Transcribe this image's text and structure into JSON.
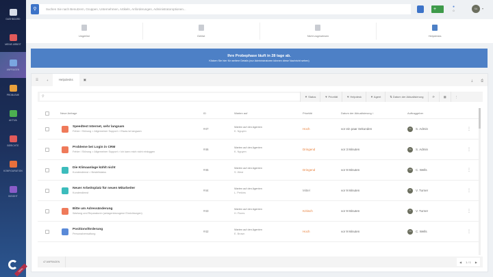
{
  "sidebar": {
    "items": [
      {
        "label": "DASHBOARD",
        "color": "#d8dde8"
      },
      {
        "label": "MEINE ARBEIT",
        "color": "#e05a5a"
      },
      {
        "label": "ANFRAGEN",
        "color": "#7aa6e0"
      },
      {
        "label": "PROBLEME",
        "color": "#e8a03c"
      },
      {
        "label": "AKTIVA",
        "color": "#4caf50"
      },
      {
        "label": "BERICHTE",
        "color": "#e05a5a"
      },
      {
        "label": "KONFIGURATION",
        "color": "#e8703c"
      },
      {
        "label": "INSIGHT",
        "color": "#8a5cc8"
      }
    ],
    "trial": "TRIAL"
  },
  "search": {
    "placeholder": "Suchen Sie nach Benutzern, Gruppen, Unternehmen, Artikeln, Anforderungen, Administratoroptionen..."
  },
  "header": {
    "notifications": "0",
    "avatar": "SA"
  },
  "nav": [
    {
      "label": "Ungelöst"
    },
    {
      "label": "Gelöst"
    },
    {
      "label": "Nicht zugewiesen"
    },
    {
      "label": "Helpdesks"
    }
  ],
  "banner": {
    "title": "Ihre Probephase läuft in 28 tage ab.",
    "subtitle": "Klicken Sie hier für weitere Details (nur Administratoren können diese Nachricht sehen)"
  },
  "tabs": {
    "active": "Helpdesks"
  },
  "filters": [
    "Status",
    "Priorität",
    "Helpdesk",
    "Agent",
    "Datum der Aktualisierung"
  ],
  "columns": [
    "Neue Anfrage",
    "ID",
    "Warten auf",
    "Priorität",
    "Datum der Aktualisierung ↕",
    "Auftraggeber"
  ],
  "rows": [
    {
      "title": "Speedtest Internet, sehr langsam",
      "path": "Fehler / Störung  >  Allgemeiner Support  >  Etwas ist langsam",
      "id": "#47",
      "wait": "Warten auf den Agenten",
      "agent": "K. Nguyen",
      "priority": "Hoch",
      "pcolor": "#e8803c",
      "date": "vor ein paar Sekunden",
      "initials": "SA",
      "requester": "S. Admin",
      "icolor": "#ef7a5a"
    },
    {
      "title": "Probleme bei Login in CRM",
      "path": "Fehler / Störung  >  Allgemeiner Support  >  Ich kann mich nicht einloggen",
      "id": "#46",
      "wait": "Warten auf den Agenten",
      "agent": "K. Nguyen",
      "priority": "Dringend",
      "pcolor": "#e8803c",
      "date": "vor 3 Minuten",
      "initials": "SA",
      "requester": "S. Admin",
      "icolor": "#ef7a5a"
    },
    {
      "title": "Die Klimaanlage kühlt nicht",
      "path": "Kundendienst  >  Bestellstatus",
      "id": "#45",
      "wait": "Warten auf den Agenten",
      "agent": "S. West",
      "priority": "Dringend",
      "pcolor": "#e8803c",
      "date": "vor 9 Minuten",
      "initials": "CW",
      "requester": "C. Wells",
      "icolor": "#3cbcbc"
    },
    {
      "title": "Neuer Arbeitsplatz für neuen Mitarbeiter",
      "path": "Kundendienst",
      "id": "#44",
      "wait": "Warten auf den Agenten",
      "agent": "L. Perkins",
      "priority": "Mittel",
      "pcolor": "#888888",
      "date": "vor 9 Minuten",
      "initials": "VT",
      "requester": "V. Turner",
      "icolor": "#3cbcbc"
    },
    {
      "title": "Bitte um Adressänderung",
      "path": "Wartung und Reparaturen (anlagenbezogene Einrichtungen)",
      "id": "#43",
      "wait": "Warten auf den Agenten",
      "agent": "H. Flores",
      "priority": "Kritisch",
      "pcolor": "#e8803c",
      "date": "vor 9 Minuten",
      "initials": "VT",
      "requester": "V. Turner",
      "icolor": "#ef7a5a"
    },
    {
      "title": "Positionsförderung",
      "path": "Personalverwaltung",
      "id": "#42",
      "wait": "Warten auf den Agenten",
      "agent": "E. Brown",
      "priority": "Hoch",
      "pcolor": "#e8803c",
      "date": "vor 9 Minuten",
      "initials": "CW",
      "requester": "C. Wells",
      "icolor": "#5a8ad8"
    }
  ],
  "footer": {
    "count": "47 ANFRAGEN",
    "page": "1 / 1"
  }
}
